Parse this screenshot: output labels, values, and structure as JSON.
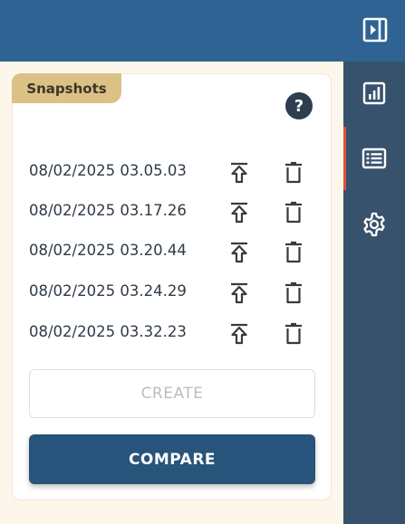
{
  "panel": {
    "title": "Snapshots",
    "help_label": "?"
  },
  "snapshots": [
    {
      "timestamp": "08/02/2025 03.05.03"
    },
    {
      "timestamp": "08/02/2025 03.17.26"
    },
    {
      "timestamp": "08/02/2025 03.20.44"
    },
    {
      "timestamp": "08/02/2025 03.24.29"
    },
    {
      "timestamp": "08/02/2025 03.32.23"
    }
  ],
  "actions": {
    "create_label": "CREATE",
    "compare_label": "COMPARE"
  },
  "sidebar": {
    "items": [
      {
        "icon": "report-chart-icon",
        "active": false
      },
      {
        "icon": "list-icon",
        "active": true
      },
      {
        "icon": "gear-icon",
        "active": false
      }
    ]
  },
  "colors": {
    "topbar": "#2f6394",
    "rail": "#37526c",
    "active_indicator": "#e0533a",
    "title_tab": "#dcc186",
    "compare_button": "#27547a",
    "background": "#fdf6ea"
  }
}
